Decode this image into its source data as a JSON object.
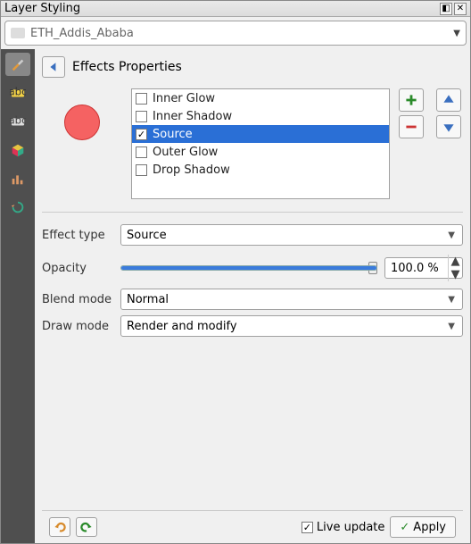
{
  "panel_title": "Layer Styling",
  "layer_name": "ETH_Addis_Ababa",
  "effects_title": "Effects Properties",
  "effects": [
    {
      "label": "Inner Glow",
      "checked": false,
      "selected": false
    },
    {
      "label": "Inner Shadow",
      "checked": false,
      "selected": false
    },
    {
      "label": "Source",
      "checked": true,
      "selected": true
    },
    {
      "label": "Outer Glow",
      "checked": false,
      "selected": false
    },
    {
      "label": "Drop Shadow",
      "checked": false,
      "selected": false
    }
  ],
  "form": {
    "effect_type_label": "Effect type",
    "effect_type_value": "Source",
    "opacity_label": "Opacity",
    "opacity_value": "100.0 %",
    "blend_mode_label": "Blend mode",
    "blend_mode_value": "Normal",
    "draw_mode_label": "Draw mode",
    "draw_mode_value": "Render and modify"
  },
  "footer": {
    "live_update_label": "Live update",
    "live_update_checked": true,
    "apply_label": "Apply"
  }
}
